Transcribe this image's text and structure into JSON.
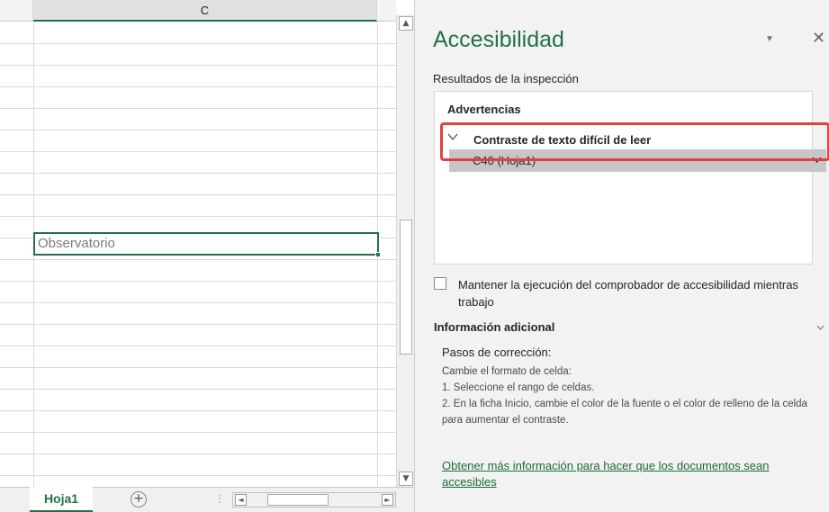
{
  "sheet": {
    "column_header": "C",
    "active_cell_value": "Observatorio",
    "tab_name": "Hoja1",
    "add_sheet_symbol": "+",
    "tab_dots": "⋮",
    "scroll_left_arrow": "◄",
    "scroll_right_arrow": "►",
    "scroll_up_arrow": "▲",
    "scroll_down_arrow": "▼"
  },
  "pane": {
    "title": "Accesibilidad",
    "menu_symbol": "▼",
    "close_symbol": "✕",
    "results_label": "Resultados de la inspección",
    "warnings_heading": "Advertencias",
    "issue": {
      "title": "Contraste de texto difícil de leer",
      "item": "C40 (Hoja1)"
    },
    "keep_running_label": "Mantener la ejecución del comprobador de accesibilidad mientras trabajo",
    "keep_running_checked": false,
    "additional_info": {
      "header": "Información adicional",
      "steps_title": "Pasos de corrección:",
      "step_intro": "Cambie el formato de celda:",
      "step_1": "1. Seleccione el rango de celdas.",
      "step_2": "2. En la ficha Inicio, cambie el color de la fuente o el color de relleno de la celda para aumentar el contraste.",
      "link": "Obtener más información para hacer que los documentos sean accesibles"
    }
  },
  "colors": {
    "excel_green": "#217346",
    "highlight_red": "#e2403f"
  },
  "icons": {
    "issue_expander": "chevron-down-icon",
    "item_dropdown": "chevron-down-icon",
    "additional_info_toggle": "chevron-down-icon",
    "pane_options": "caret-down-icon",
    "pane_close": "close-icon",
    "add_sheet": "plus-circle-icon"
  }
}
